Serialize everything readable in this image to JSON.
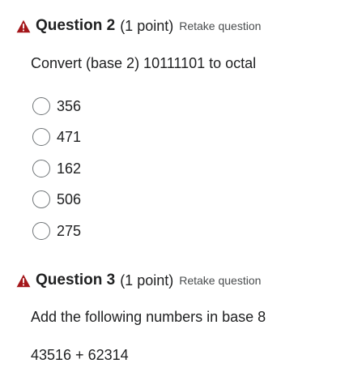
{
  "questions": [
    {
      "title": "Question 2",
      "points": "(1 point)",
      "retake": "Retake question",
      "warning_icon": "warning-triangle-icon",
      "text": "Convert (base 2) 10111101 to octal",
      "options": [
        "356",
        "471",
        "162",
        "506",
        "275"
      ]
    },
    {
      "title": "Question 3",
      "points": "(1 point)",
      "retake": "Retake question",
      "warning_icon": "warning-triangle-icon",
      "text": "Add the following numbers in base 8",
      "expression": "43516 + 62314"
    }
  ],
  "colors": {
    "warning": "#a4161a",
    "text": "#202122",
    "muted": "#494c4e"
  }
}
